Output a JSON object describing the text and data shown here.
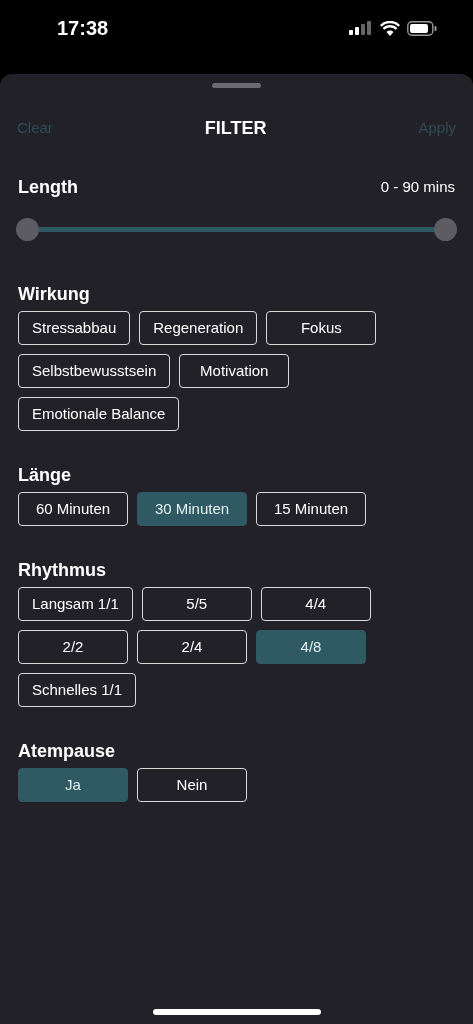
{
  "status_bar": {
    "time": "17:38"
  },
  "header": {
    "left": "Clear",
    "title": "FILTER",
    "right": "Apply"
  },
  "length": {
    "label": "Length",
    "reading": "0 - 90 mins",
    "level": 1
  },
  "groups": [
    {
      "title": "Wirkung",
      "options": [
        {
          "label": "Stressabbau",
          "selected": false
        },
        {
          "label": "Regeneration",
          "selected": false
        },
        {
          "label": "Fokus",
          "selected": false
        },
        {
          "label": "Selbstbewusstsein",
          "selected": false
        },
        {
          "label": "Motivation",
          "selected": false
        },
        {
          "label": "Emotionale Balance",
          "selected": false
        }
      ]
    },
    {
      "title": "Länge",
      "options": [
        {
          "label": "60 Minuten",
          "selected": false
        },
        {
          "label": "30 Minuten",
          "selected": true
        },
        {
          "label": "15 Minuten",
          "selected": false
        }
      ]
    },
    {
      "title": "Rhythmus",
      "options": [
        {
          "label": "Langsam 1/1",
          "selected": false
        },
        {
          "label": "5/5",
          "selected": false
        },
        {
          "label": "4/4",
          "selected": false
        },
        {
          "label": "2/2",
          "selected": false
        },
        {
          "label": "2/4",
          "selected": false
        },
        {
          "label": "4/8",
          "selected": true
        },
        {
          "label": "Schnelles 1/1",
          "selected": false
        }
      ]
    },
    {
      "title": "Atempause",
      "options": [
        {
          "label": "Ja",
          "selected": true
        },
        {
          "label": "Nein",
          "selected": false
        }
      ]
    }
  ]
}
